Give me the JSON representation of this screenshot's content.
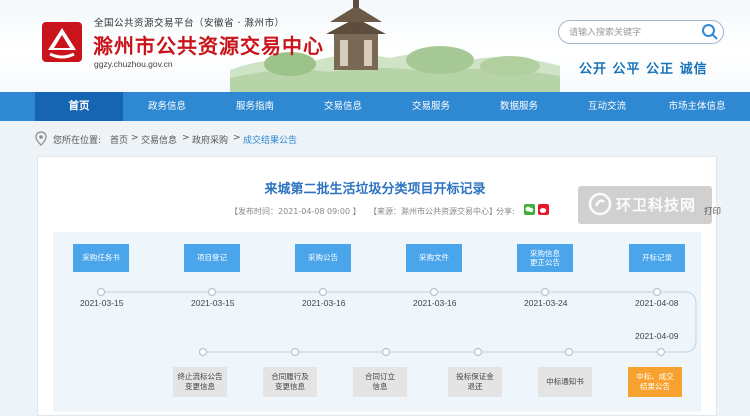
{
  "header": {
    "site_sub": "全国公共资源交易平台（安徽省 · 滁州市）",
    "site_title": "滁州市公共资源交易中心",
    "site_url": "ggzy.chuzhou.gov.cn",
    "search_placeholder": "请输入搜索关键字",
    "slogan": "公开 公平 公正 诚信",
    "colors": {
      "brand_red": "#c8141a",
      "nav_blue": "#2f88d2",
      "nav_active": "#1565b3",
      "step_blue": "#4aa5ea",
      "step_orange": "#f7a22e"
    }
  },
  "nav": {
    "items": [
      {
        "label": "首页"
      },
      {
        "label": "政务信息"
      },
      {
        "label": "服务指南"
      },
      {
        "label": "交易信息"
      },
      {
        "label": "交易服务"
      },
      {
        "label": "数据服务"
      },
      {
        "label": "互动交流"
      },
      {
        "label": "市场主体信息"
      }
    ]
  },
  "breadcrumb": {
    "prefix": "您所在位置:",
    "items": [
      "首页",
      ">",
      "交易信息",
      ">",
      "政府采购",
      ">",
      "成交结果公告"
    ]
  },
  "article": {
    "title": "来城第二批生活垃圾分类项目开标记录",
    "published": "【发布时间：2021-04-08 09:00 】",
    "source": "【来源：滁州市公共资源交易中心】",
    "share": "分享:",
    "print": "打印",
    "watermark": "环卫科技网"
  },
  "timeline": {
    "top_steps": [
      {
        "label": "采购任务书",
        "date": "2021-03-15"
      },
      {
        "label": "项目登记",
        "date": "2021-03-15"
      },
      {
        "label": "采购公告",
        "date": "2021-03-16"
      },
      {
        "label": "采购文件",
        "date": "2021-03-16"
      },
      {
        "label": "采购信息\n更正公告",
        "date": "2021-03-24"
      },
      {
        "label": "开标记录",
        "date": "2021-04-08"
      }
    ],
    "bottom_date": "2021-04-09",
    "bottom_steps": [
      {
        "label": "终止流标公告\n变更信息"
      },
      {
        "label": "合同履行及\n变更信息"
      },
      {
        "label": "合同订立\n信息"
      },
      {
        "label": "投标保证金\n退还"
      },
      {
        "label": "中标通知书"
      },
      {
        "label": "中标、成交\n结果公告"
      }
    ]
  }
}
